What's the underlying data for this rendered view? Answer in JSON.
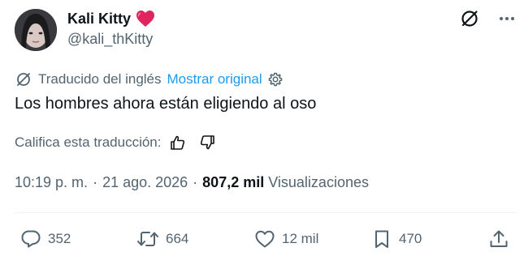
{
  "author": {
    "display_name": "Kali Kitty",
    "handle": "@kali_thKitty"
  },
  "icons": {
    "heart_emoji": "heart-emoji",
    "grok": "slashed-circle-icon",
    "more": "more-dots-icon",
    "translate": "slashed-circle-icon",
    "settings": "gear-icon",
    "thumbs_up": "thumbs-up-icon",
    "thumbs_down": "thumbs-down-icon",
    "reply": "reply-icon",
    "repost": "repost-icon",
    "like": "like-icon",
    "bookmark": "bookmark-icon",
    "share": "share-icon"
  },
  "translation": {
    "label": "Traducido del inglés",
    "show_original": "Mostrar original"
  },
  "tweet": {
    "text": "Los hombres ahora están eligiendo al oso"
  },
  "rating": {
    "label": "Califica esta traducción:"
  },
  "meta": {
    "time": "10:19 p. m.",
    "separator": "·",
    "date": "21 ago. 2026",
    "views_count": "807,2 mil",
    "views_label": "Visualizaciones"
  },
  "actions": {
    "replies": "352",
    "reposts": "664",
    "likes": "12 mil",
    "bookmarks": "470"
  },
  "colors": {
    "text": "#0f1419",
    "muted": "#536471",
    "link": "#1d9bf0",
    "heart": "#e0245e",
    "divider": "#eff3f4"
  }
}
